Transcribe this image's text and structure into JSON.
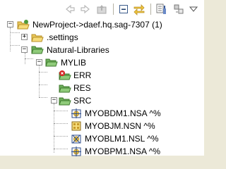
{
  "toolbar": {
    "buttons": [
      {
        "name": "back-icon",
        "glyph": "⇦"
      },
      {
        "name": "forward-icon",
        "glyph": "⇨"
      },
      {
        "name": "go-up-icon",
        "glyph": "⇧"
      },
      {
        "name": "collapse-all-icon",
        "glyph": "⊟"
      },
      {
        "name": "link-with-editor-icon",
        "glyph": "⇆"
      },
      {
        "name": "filter-icon",
        "glyph": "▤"
      },
      {
        "name": "view-menu-icon",
        "glyph": "▽"
      }
    ]
  },
  "tree": {
    "items": [
      {
        "label": "NewProject->daef.hq.sag-7307 (1)",
        "icon": "project-icon",
        "toggle": "−",
        "depth": 0
      },
      {
        "label": ".settings",
        "icon": "folder-icon",
        "toggle": "+",
        "depth": 1
      },
      {
        "label": "Natural-Libraries",
        "icon": "folder-open-icon",
        "toggle": "−",
        "depth": 1
      },
      {
        "label": "MYLIB",
        "icon": "library-folder-icon",
        "toggle": "−",
        "depth": 2
      },
      {
        "label": "ERR",
        "icon": "err-folder-icon",
        "toggle": "",
        "depth": 3
      },
      {
        "label": "RES",
        "icon": "res-folder-icon",
        "toggle": "",
        "depth": 3
      },
      {
        "label": "SRC",
        "icon": "src-folder-icon",
        "toggle": "−",
        "depth": 3
      },
      {
        "label": "MYOBDM1.NSA  ^%",
        "icon": "data-area-icon",
        "toggle": "",
        "depth": 4
      },
      {
        "label": "MYOBJM.NSN  ^%",
        "icon": "subprogram-icon",
        "toggle": "",
        "depth": 4
      },
      {
        "label": "MYOBLM1.NSL  ^%",
        "icon": "local-data-area-icon",
        "toggle": "",
        "depth": 4
      },
      {
        "label": "MYOBPM1.NSA  ^%",
        "icon": "parameter-data-area-icon",
        "toggle": "",
        "depth": 4
      }
    ]
  },
  "colors": {
    "folder": "#e8c75a",
    "folder_dark": "#b8902a",
    "project_green": "#4f9a3c",
    "error_red": "#d42020"
  }
}
